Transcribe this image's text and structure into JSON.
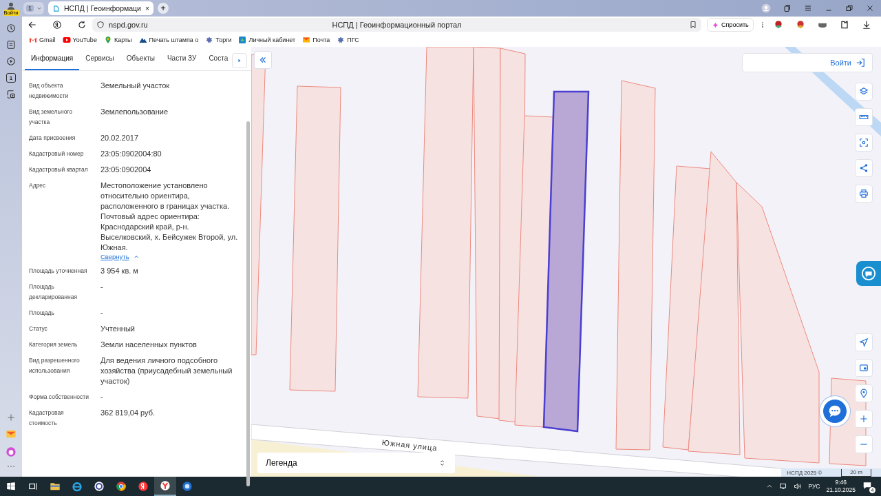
{
  "browser": {
    "profile_label": "Войти",
    "tab_counter": "1",
    "tab": {
      "title": "НСПД | Геоинформаци",
      "close": "×"
    },
    "new_tab": "+",
    "window_title": "НСПД | Геоинформационный портал",
    "address": "nspd.gov.ru",
    "ask_button": "Спросить",
    "sidebar_counter": "1",
    "bookmarks": [
      {
        "label": "Gmail",
        "kind": "mail-m"
      },
      {
        "label": "YouTube",
        "kind": "play"
      },
      {
        "label": "Карты",
        "kind": "pin"
      },
      {
        "label": "Печать штампа о",
        "kind": "mountain"
      },
      {
        "label": "Торги",
        "kind": "emblem"
      },
      {
        "label": "Личный кабинет",
        "kind": "square"
      },
      {
        "label": "Почта",
        "kind": "envelope"
      },
      {
        "label": "ПГС",
        "kind": "emblem"
      }
    ]
  },
  "panel": {
    "tabs": [
      {
        "label": "Информация",
        "selected": true
      },
      {
        "label": "Сервисы",
        "selected": false
      },
      {
        "label": "Объекты",
        "selected": false
      },
      {
        "label": "Части ЗУ",
        "selected": false
      },
      {
        "label": "Соста",
        "selected": false
      }
    ],
    "rows": [
      {
        "label": "Вид объекта недвижимости",
        "value": "Земельный участок"
      },
      {
        "label": "Вид земельного участка",
        "value": "Землепользование"
      },
      {
        "label": "Дата присвоения",
        "value": "20.02.2017"
      },
      {
        "label": "Кадастровый номер",
        "value": "23:05:0902004:80"
      },
      {
        "label": "Кадастровый квартал",
        "value": "23:05:0902004"
      },
      {
        "label": "Адрес",
        "value": "Местоположение установлено относительно ориентира, расположенного в границах участка. Почтовый адрес ориентира: Краснодарский край, р-н. Выселковский, х. Бейсужек Второй, ул. Южная.",
        "link": "Свернуть"
      },
      {
        "label": "Площадь уточненная",
        "value": "3 954 кв. м"
      },
      {
        "label": "Площадь декларированная",
        "value": "-"
      },
      {
        "label": "Площадь",
        "value": "-"
      },
      {
        "label": "Статус",
        "value": "Учтенный"
      },
      {
        "label": "Категория земель",
        "value": "Земли населенных пунктов"
      },
      {
        "label": "Вид разрешенного использования",
        "value": "Для ведения личного подсобного хозяйства (приусадебный земельный участок)"
      },
      {
        "label": "Форма собственности",
        "value": "-"
      },
      {
        "label": "Кадастровая стоимость",
        "value": "362 819,04 руб."
      }
    ]
  },
  "map": {
    "login_button": "Войти",
    "road_label": "Южная улица",
    "legend": "Легенда",
    "attribution": "НСПД 2025 ©",
    "scale": "20 m"
  },
  "taskbar": {
    "language": "РУС",
    "time": "9:46",
    "date": "21.10.2025",
    "notifications": "4"
  }
}
